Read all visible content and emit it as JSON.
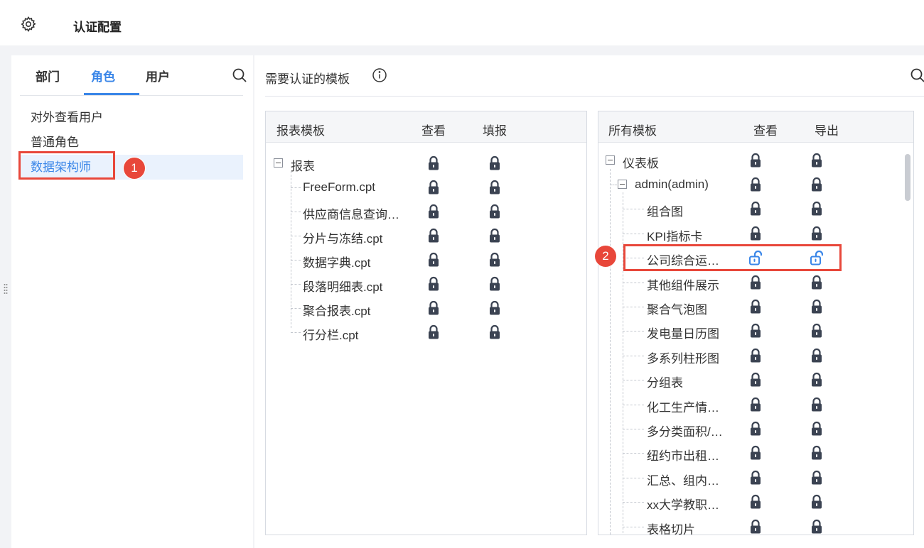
{
  "header": {
    "title": "认证配置",
    "settings_icon": "gear-icon"
  },
  "left": {
    "tabs": [
      {
        "label": "部门",
        "active": false
      },
      {
        "label": "角色",
        "active": true
      },
      {
        "label": "用户",
        "active": false
      }
    ],
    "search_icon": "search-icon",
    "roles": [
      {
        "label": "对外查看用户",
        "selected": false
      },
      {
        "label": "普通角色",
        "selected": false
      },
      {
        "label": "数据架构师",
        "selected": true
      }
    ],
    "annotation_1": "1"
  },
  "right": {
    "title": "需要认证的模板",
    "info_icon": "info-icon",
    "search_icon": "search-icon",
    "report_panel": {
      "columns": [
        "报表模板",
        "查看",
        "填报"
      ],
      "root": "报表",
      "items": [
        "FreeForm.cpt",
        "供应商信息查询…",
        "分片与冻结.cpt",
        "数据字典.cpt",
        "段落明细表.cpt",
        "聚合报表.cpt",
        "行分栏.cpt"
      ]
    },
    "all_panel": {
      "columns": [
        "所有模板",
        "查看",
        "导出"
      ],
      "root": "仪表板",
      "sub": "admin(admin)",
      "items": [
        {
          "label": "组合图",
          "locked": true
        },
        {
          "label": "KPI指标卡",
          "locked": true
        },
        {
          "label": "公司综合运…",
          "locked": false
        },
        {
          "label": "其他组件展示",
          "locked": true
        },
        {
          "label": "聚合气泡图",
          "locked": true
        },
        {
          "label": "发电量日历图",
          "locked": true
        },
        {
          "label": "多系列柱形图",
          "locked": true
        },
        {
          "label": "分组表",
          "locked": true
        },
        {
          "label": "化工生产情…",
          "locked": true
        },
        {
          "label": "多分类面积/…",
          "locked": true
        },
        {
          "label": "纽约市出租…",
          "locked": true
        },
        {
          "label": "汇总、组内…",
          "locked": true
        },
        {
          "label": "xx大学教职…",
          "locked": true
        },
        {
          "label": "表格切片",
          "locked": true
        }
      ],
      "annotation_2": "2"
    }
  },
  "colors": {
    "accent": "#3a86e8",
    "highlight": "#e8473a",
    "lock_dark": "#3b4352"
  }
}
